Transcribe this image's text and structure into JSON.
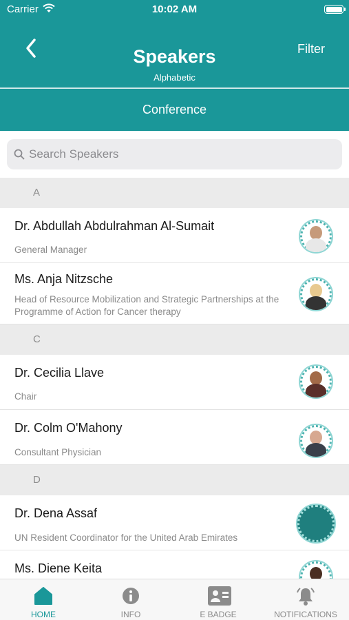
{
  "status_bar": {
    "carrier": "Carrier",
    "time": "10:02 AM"
  },
  "header": {
    "title": "Speakers",
    "subtitle": "Alphabetic",
    "filter_label": "Filter",
    "tab_label": "Conference"
  },
  "search": {
    "placeholder": "Search Speakers"
  },
  "sections": [
    {
      "letter": "A",
      "speakers": [
        {
          "name": "Dr. Abdullah Abdulrahman Al-Sumait",
          "role": "General Manager"
        },
        {
          "name": "Ms. Anja Nitzsche",
          "role": "Head of Resource Mobilization and Strategic Partnerships at the Programme of Action for Cancer therapy"
        }
      ]
    },
    {
      "letter": "C",
      "speakers": [
        {
          "name": "Dr. Cecilia Llave",
          "role": "Chair"
        },
        {
          "name": "Dr. Colm O'Mahony",
          "role": "Consultant Physician"
        }
      ]
    },
    {
      "letter": "D",
      "speakers": [
        {
          "name": "Dr. Dena Assaf",
          "role": "UN Resident Coordinator for the United Arab Emirates"
        },
        {
          "name": "Ms. Diene Keita",
          "role": ""
        }
      ]
    }
  ],
  "tabbar": {
    "items": [
      {
        "label": "HOME",
        "icon": "home-icon",
        "active": true
      },
      {
        "label": "INFO",
        "icon": "info-icon",
        "active": false
      },
      {
        "label": "E BADGE",
        "icon": "badge-icon",
        "active": false
      },
      {
        "label": "NOTIFICATIONS",
        "icon": "bell-icon",
        "active": false
      }
    ]
  },
  "colors": {
    "brand": "#1a9799",
    "section_bg": "#ebebeb",
    "inactive_tab": "#8b8b8b"
  }
}
